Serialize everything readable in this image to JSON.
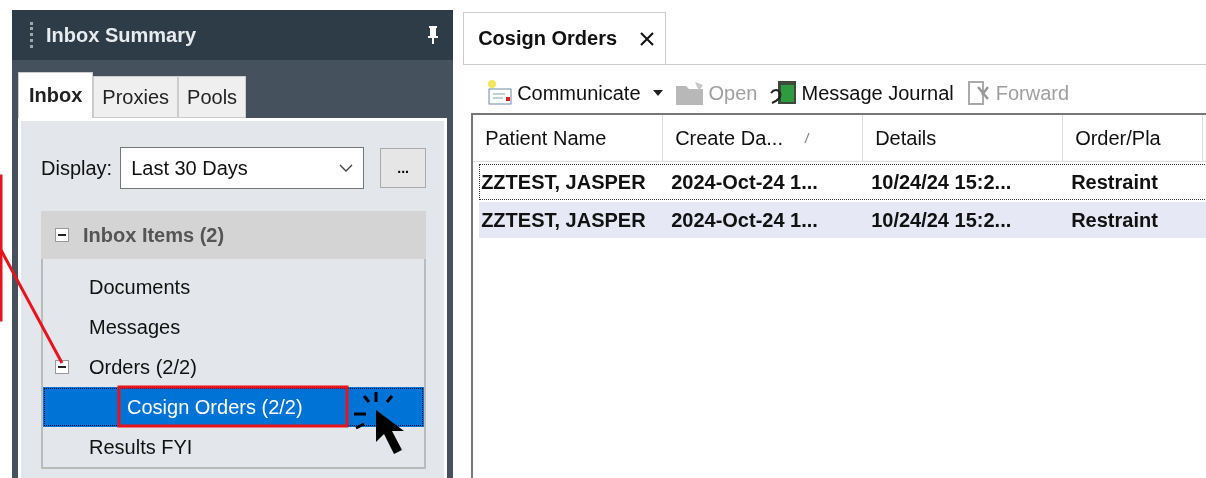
{
  "left_panel": {
    "title": "Inbox Summary",
    "tabs": [
      {
        "label": "Inbox",
        "selected": true
      },
      {
        "label": "Proxies",
        "selected": false
      },
      {
        "label": "Pools",
        "selected": false
      }
    ],
    "display": {
      "label": "Display:",
      "value": "Last 30 Days",
      "more_button": "..."
    },
    "tree": {
      "label": "Inbox Items (2)",
      "expanded": true,
      "children": [
        {
          "label": "Documents",
          "selected": false
        },
        {
          "label": "Messages",
          "selected": false
        },
        {
          "label": "Orders (2/2)",
          "selected": false,
          "expanded": true,
          "children": [
            {
              "label": "Cosign Orders (2/2)",
              "selected": true
            }
          ]
        },
        {
          "label": "Results FYI",
          "selected": false
        }
      ]
    }
  },
  "right_panel": {
    "tab": {
      "label": "Cosign Orders",
      "selected": true
    },
    "toolbar": [
      {
        "kind": "communicate",
        "label": "Communicate",
        "disabled": false,
        "dropdown": true
      },
      {
        "kind": "open",
        "label": "Open",
        "disabled": true,
        "dropdown": false
      },
      {
        "kind": "journal",
        "label": "Message Journal",
        "disabled": false,
        "dropdown": false
      },
      {
        "kind": "forward",
        "label": "Forward",
        "disabled": true,
        "dropdown": false
      }
    ],
    "table": {
      "columns": [
        {
          "label": "Patient Name",
          "sorted": false
        },
        {
          "label": "Create Da...",
          "sorted": true
        },
        {
          "label": "Details",
          "sorted": false
        },
        {
          "label": "Order/Pla",
          "sorted": false
        }
      ],
      "rows": [
        {
          "cells": [
            "ZZTEST, JASPER",
            "2024-Oct-24 1...",
            "10/24/24 15:2...",
            "Restraint"
          ],
          "selected": false,
          "focused": true
        },
        {
          "cells": [
            "ZZTEST, JASPER",
            "2024-Oct-24 1...",
            "10/24/24 15:2...",
            "Restraint"
          ],
          "selected": true,
          "focused": false
        }
      ]
    }
  }
}
